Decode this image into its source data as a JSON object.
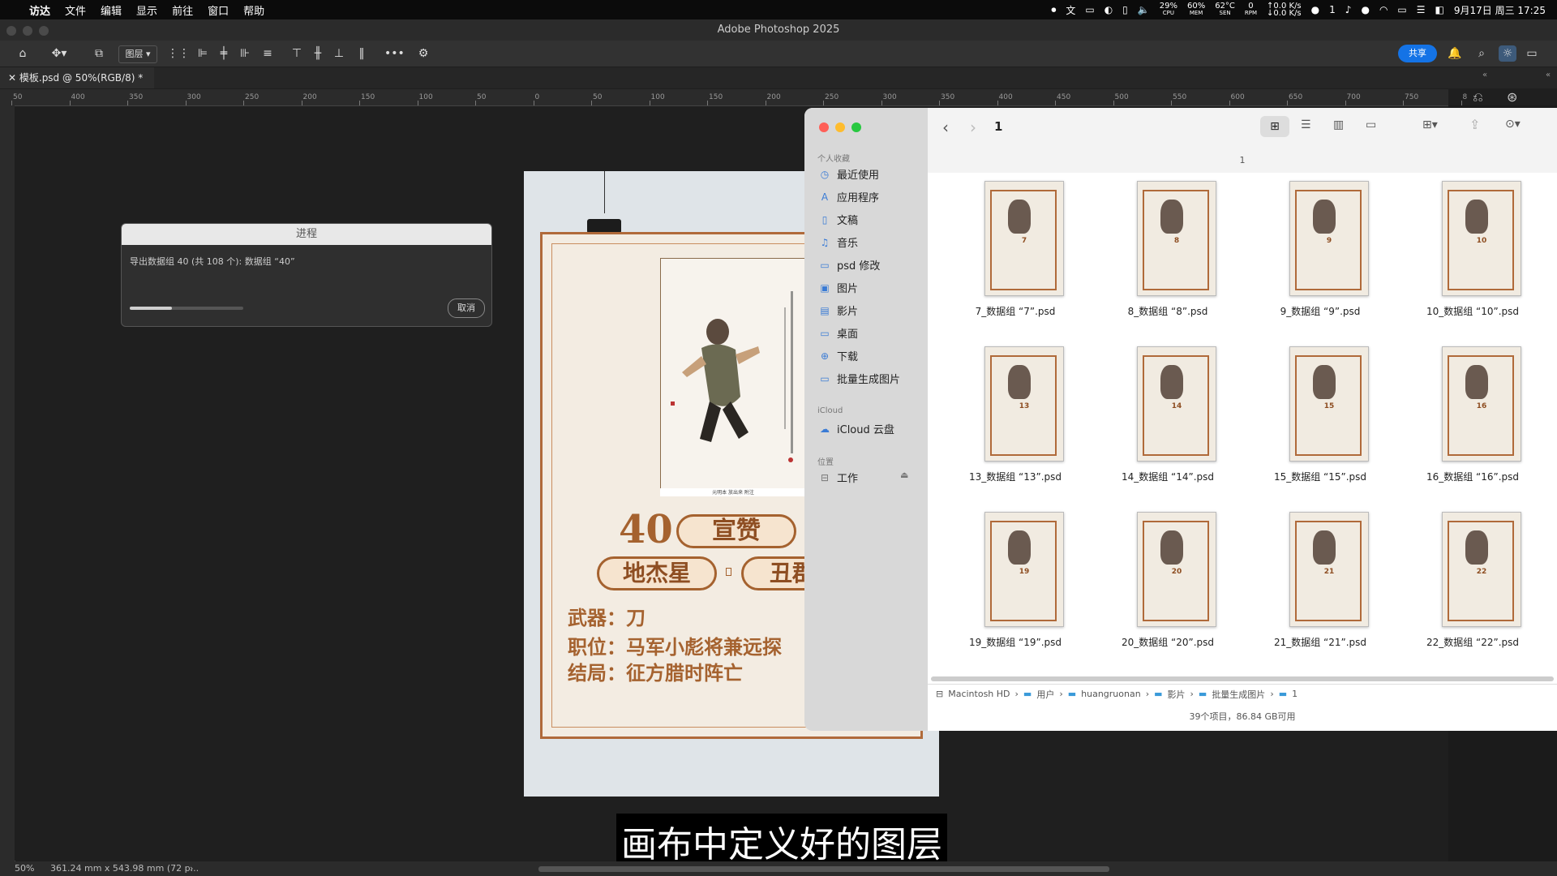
{
  "menubar": {
    "app": "访达",
    "items": [
      "文件",
      "编辑",
      "显示",
      "前往",
      "窗口",
      "帮助"
    ],
    "cpu": "29%",
    "cpu_label": "CPU",
    "mem": "60%",
    "mem_label": "MEM",
    "temp": "62°C",
    "temp_label": "SEN",
    "rpm": "0",
    "rpm_label": "RPM",
    "net_up": "↑0.0 K/s",
    "net_down": "↓0.0 K/s",
    "wechat_count": "1",
    "datetime": "9月17日 周三  17:25"
  },
  "photoshop": {
    "window_title": "Adobe Photoshop 2025",
    "layer_select": "图层",
    "share_label": "共享",
    "doc_tab": "模板.psd @ 50%(RGB/8) *",
    "zoom": "50%",
    "doc_info": "361.24 mm x 543.98 mm (72 p...",
    "ruler_top": [
      "50",
      "400",
      "350",
      "300",
      "250",
      "200",
      "150",
      "100",
      "50",
      "0",
      "50",
      "100",
      "150",
      "200",
      "250",
      "300",
      "350",
      "400",
      "450",
      "500",
      "550",
      "600",
      "650",
      "700",
      "750",
      "8"
    ]
  },
  "poster": {
    "number": "40",
    "name": "宣赞",
    "star": "地杰星",
    "nickname": "丑郡",
    "weapon": "武器：刀",
    "position": "职位：马军小彪将兼远探",
    "ending": "结局：征方腊时阵亡",
    "caption": "元明本 放出来 附注"
  },
  "progress_dialog": {
    "title": "进程",
    "message": "导出数据组 40 (共 108 个): 数据组 “40”",
    "progress": 0.37,
    "cancel_label": "取消"
  },
  "finder": {
    "folder_title": "1",
    "column_title": "1",
    "sidebar": {
      "favorites_label": "个人收藏",
      "favorites": [
        {
          "label": "最近使用",
          "icon": "clock-icon"
        },
        {
          "label": "应用程序",
          "icon": "apps-icon"
        },
        {
          "label": "文稿",
          "icon": "document-icon"
        },
        {
          "label": "音乐",
          "icon": "music-icon"
        },
        {
          "label": "psd 修改",
          "icon": "folder-icon"
        },
        {
          "label": "图片",
          "icon": "photo-icon"
        },
        {
          "label": "影片",
          "icon": "film-icon"
        },
        {
          "label": "桌面",
          "icon": "desktop-icon"
        },
        {
          "label": "下载",
          "icon": "download-icon"
        },
        {
          "label": "批量生成图片",
          "icon": "folder-icon"
        }
      ],
      "icloud_label": "iCloud",
      "icloud": [
        {
          "label": "iCloud 云盘",
          "icon": "cloud-icon"
        }
      ],
      "locations_label": "位置",
      "locations": [
        {
          "label": "工作",
          "icon": "drive-icon"
        }
      ]
    },
    "files": [
      {
        "name": "7_数据组 “7”.psd",
        "num": "7"
      },
      {
        "name": "8_数据组 “8”.psd",
        "num": "8"
      },
      {
        "name": "9_数据组 “9”.psd",
        "num": "9"
      },
      {
        "name": "10_数据组 “10”.psd",
        "num": "10"
      },
      {
        "name": "13_数据组 “13”.psd",
        "num": "13"
      },
      {
        "name": "14_数据组 “14”.psd",
        "num": "14"
      },
      {
        "name": "15_数据组 “15”.psd",
        "num": "15"
      },
      {
        "name": "16_数据组 “16”.psd",
        "num": "16"
      },
      {
        "name": "19_数据组 “19”.psd",
        "num": "19"
      },
      {
        "name": "20_数据组 “20”.psd",
        "num": "20"
      },
      {
        "name": "21_数据组 “21”.psd",
        "num": "21"
      },
      {
        "name": "22_数据组 “22”.psd",
        "num": "22"
      }
    ],
    "path": [
      "Macintosh HD",
      "用户",
      "huangruonan",
      "影片",
      "批量生成图片",
      "1"
    ],
    "status": "39个项目，86.84 GB可用"
  },
  "subtitle": "画布中定义好的图层",
  "colors": {
    "accent": "#1473e6",
    "poster_brown": "#a5622f",
    "close": "#ff5f57",
    "minimize": "#febc2e",
    "zoom": "#28c840"
  }
}
